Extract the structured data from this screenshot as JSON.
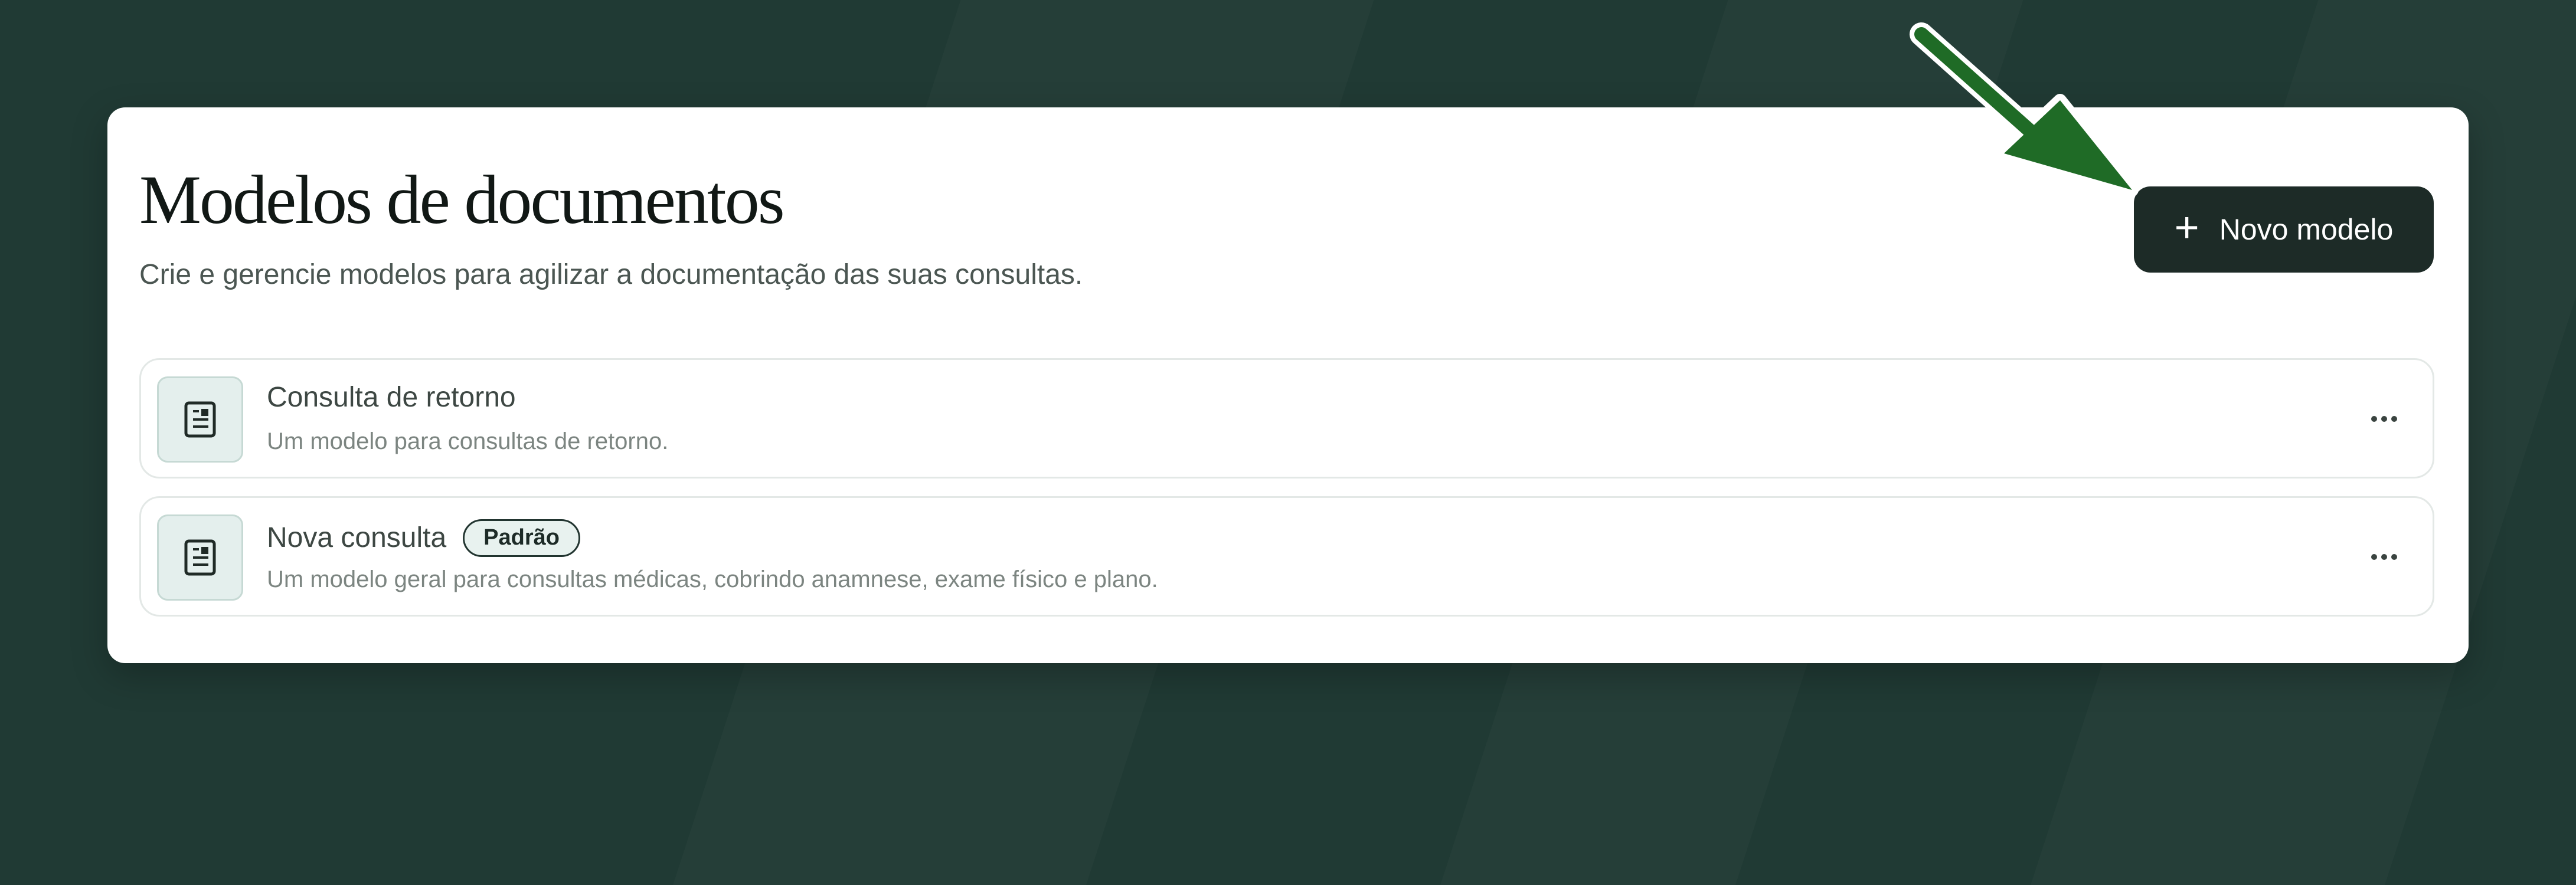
{
  "page": {
    "title": "Modelos de documentos",
    "subtitle": "Crie e gerencie modelos para agilizar a documentação das suas consultas."
  },
  "toolbar": {
    "new_model_label": "Novo modelo",
    "new_model_icon": "plus-icon"
  },
  "templates": [
    {
      "name": "Consulta de retorno",
      "description": "Um modelo para consultas de retorno.",
      "icon": "document-icon",
      "badge": ""
    },
    {
      "name": "Nova consulta",
      "description": "Um modelo geral para consultas médicas, cobrindo anamnese, exame físico e plano.",
      "icon": "document-icon",
      "badge": "Padrão"
    }
  ],
  "colors": {
    "background": "#203a34",
    "card": "#ffffff",
    "primary_button": "#1d2b27",
    "icon_tile": "#e4efed",
    "annotation_arrow": "#1f6b26"
  }
}
